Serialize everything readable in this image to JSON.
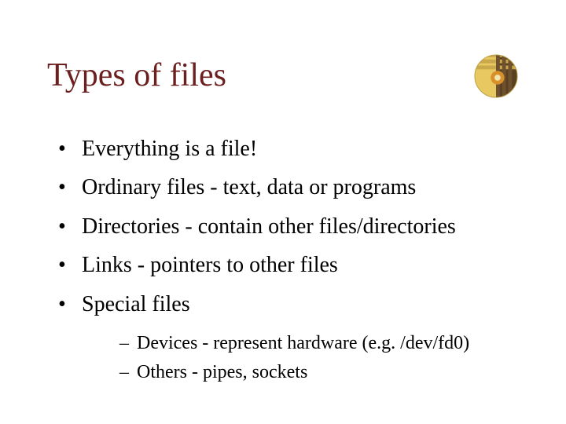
{
  "title": "Types of files",
  "bullets": {
    "b0": "Everything is a file!",
    "b1": "Ordinary files - text, data or programs",
    "b2": "Directories - contain other files/directories",
    "b3": "Links - pointers to other files",
    "b4": "Special files"
  },
  "sub": {
    "s0": "Devices - represent hardware (e.g. /dev/fd0)",
    "s1": "Others - pipes, sockets"
  }
}
